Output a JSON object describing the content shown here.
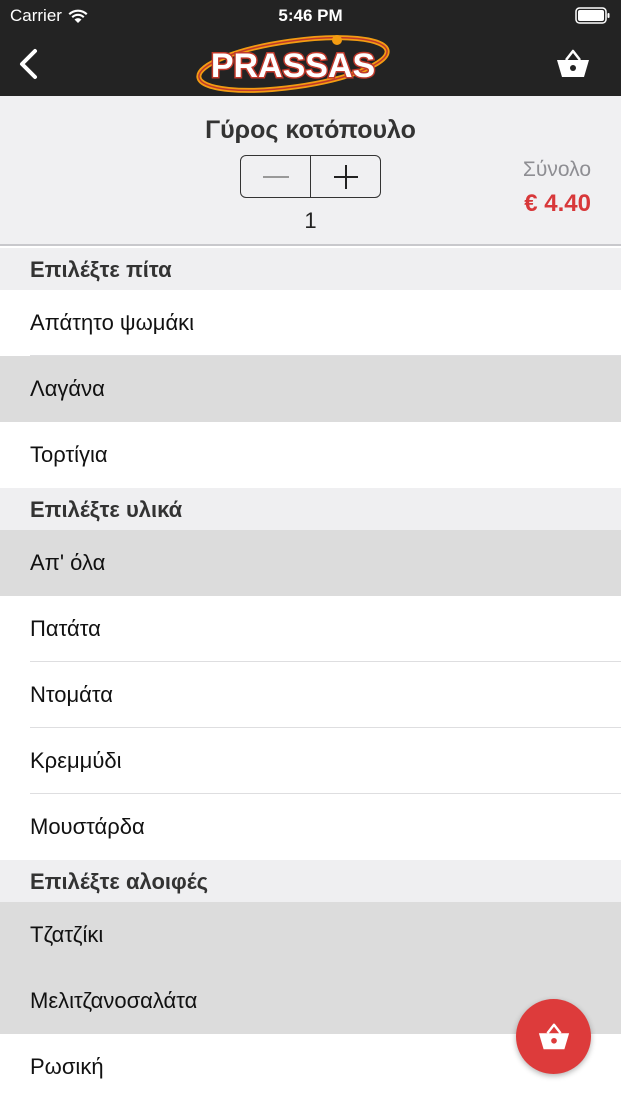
{
  "status_bar": {
    "carrier": "Carrier",
    "time": "5:46 PM"
  },
  "nav": {
    "logo_text": "PRASSAS",
    "back_icon": "chevron-left-icon",
    "cart_icon": "basket-icon"
  },
  "product": {
    "title": "Γύρος κοτόπουλο",
    "quantity": "1",
    "decrement_label": "—",
    "increment_label": "+",
    "total_label": "Σύνολο",
    "total_value": "€ 4.40"
  },
  "sections": [
    {
      "title": "Επιλέξτε πίτα",
      "items": [
        {
          "label": "Απάτητο ψωμάκι",
          "selected": false
        },
        {
          "label": "Λαγάνα",
          "selected": true
        },
        {
          "label": "Τορτίγια",
          "selected": false
        }
      ]
    },
    {
      "title": "Επιλέξτε υλικά",
      "items": [
        {
          "label": "Απ' όλα",
          "selected": true
        },
        {
          "label": "Πατάτα",
          "selected": false
        },
        {
          "label": "Ντομάτα",
          "selected": false
        },
        {
          "label": "Κρεμμύδι",
          "selected": false
        },
        {
          "label": "Μουστάρδα",
          "selected": false
        }
      ]
    },
    {
      "title": "Επιλέξτε αλοιφές",
      "items": [
        {
          "label": "Τζατζίκι",
          "selected": true
        },
        {
          "label": "Μελιτζανοσαλάτα",
          "selected": true
        },
        {
          "label": "Ρωσική",
          "selected": false
        }
      ]
    }
  ],
  "colors": {
    "bar_background": "#232323",
    "accent_red": "#d8383a",
    "selected_row": "#dcdcdc"
  }
}
